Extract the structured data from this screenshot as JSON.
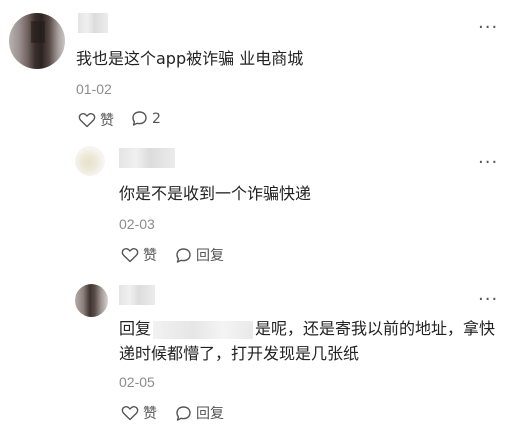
{
  "comments": [
    {
      "text": "我也是这个app被诈骗 业电商城",
      "date": "01-02",
      "like_label": "赞",
      "reply_count": "2"
    },
    {
      "text": "你是不是收到一个诈骗快递",
      "date": "02-03",
      "like_label": "赞",
      "reply_label": "回复"
    },
    {
      "reply_prefix": "回复",
      "text_line1": "是呢，还是寄我以前的地址，拿快",
      "text_line2": "递时候都懵了，打开发现是几张纸",
      "date": "02-05",
      "like_label": "赞",
      "reply_label": "回复"
    }
  ],
  "more_glyph": "···"
}
